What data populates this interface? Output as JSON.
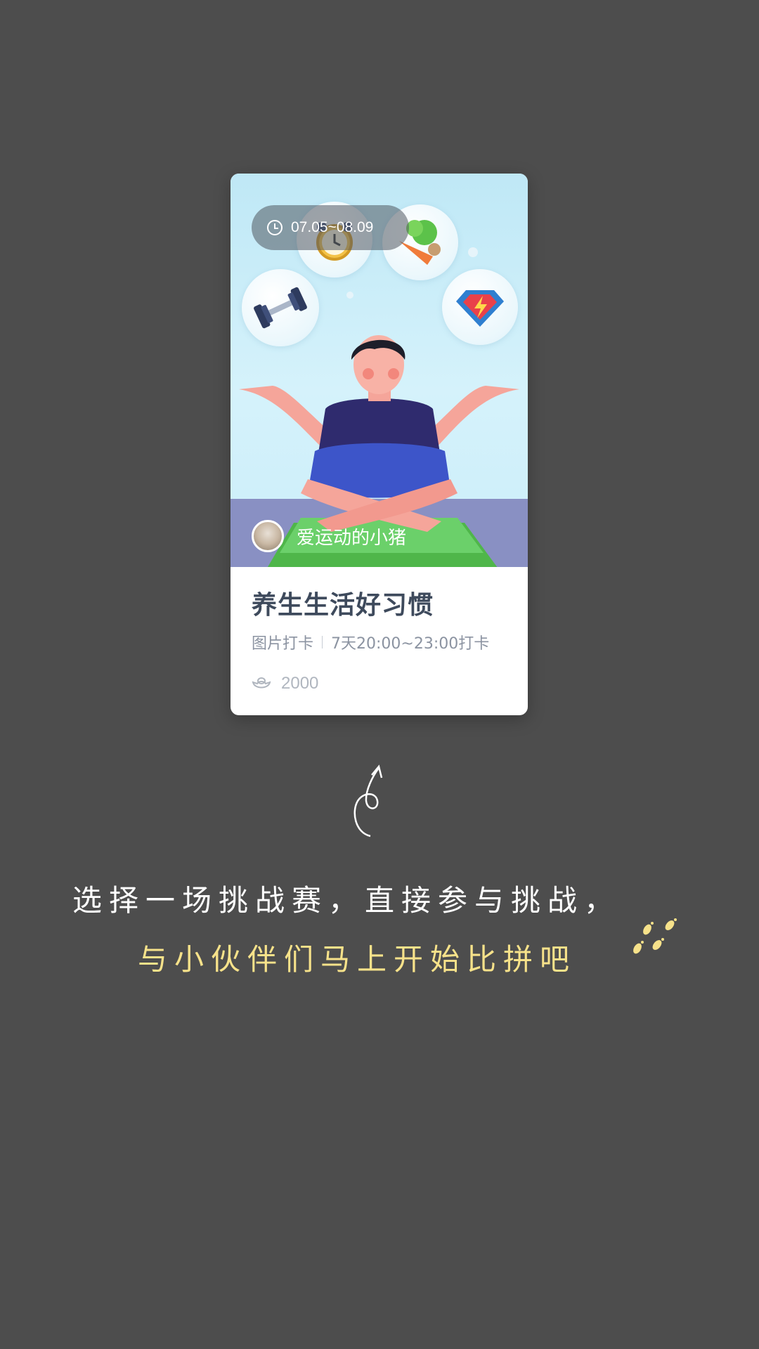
{
  "card": {
    "date_range": "07.05~08.09",
    "author_name": "爱运动的小猪",
    "title": "养生生活好习惯",
    "checkin_type": "图片打卡",
    "schedule": "7天20:00~23:00打卡",
    "reward": "2000",
    "icons": [
      "clock-icon",
      "alarm-clock-icon",
      "vegetables-icon",
      "dumbbell-icon",
      "superhero-shield-icon",
      "ingot-icon"
    ]
  },
  "caption": {
    "line1": "选择一场挑战赛，直接参与挑战，",
    "line2": "与小伙伴们马上开始比拼吧"
  },
  "colors": {
    "background": "#4d4d4d",
    "caption_line1": "#ffffff",
    "caption_line2": "#f7e28a",
    "title": "#3e4a5c"
  }
}
